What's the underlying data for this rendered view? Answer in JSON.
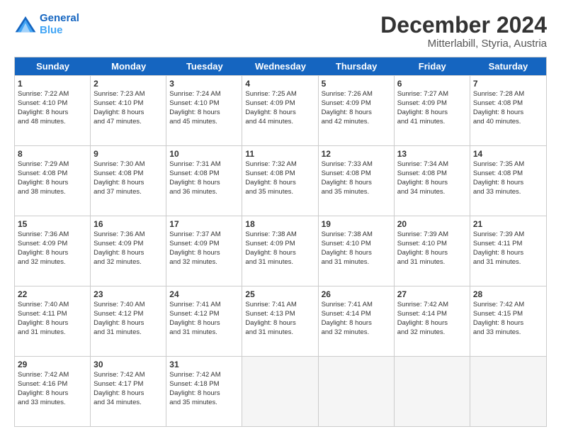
{
  "header": {
    "logo_line1": "General",
    "logo_line2": "Blue",
    "month": "December 2024",
    "location": "Mitterlabill, Styria, Austria"
  },
  "weekdays": [
    "Sunday",
    "Monday",
    "Tuesday",
    "Wednesday",
    "Thursday",
    "Friday",
    "Saturday"
  ],
  "weeks": [
    [
      {
        "day": "1",
        "lines": [
          "Sunrise: 7:22 AM",
          "Sunset: 4:10 PM",
          "Daylight: 8 hours",
          "and 48 minutes."
        ]
      },
      {
        "day": "2",
        "lines": [
          "Sunrise: 7:23 AM",
          "Sunset: 4:10 PM",
          "Daylight: 8 hours",
          "and 47 minutes."
        ]
      },
      {
        "day": "3",
        "lines": [
          "Sunrise: 7:24 AM",
          "Sunset: 4:10 PM",
          "Daylight: 8 hours",
          "and 45 minutes."
        ]
      },
      {
        "day": "4",
        "lines": [
          "Sunrise: 7:25 AM",
          "Sunset: 4:09 PM",
          "Daylight: 8 hours",
          "and 44 minutes."
        ]
      },
      {
        "day": "5",
        "lines": [
          "Sunrise: 7:26 AM",
          "Sunset: 4:09 PM",
          "Daylight: 8 hours",
          "and 42 minutes."
        ]
      },
      {
        "day": "6",
        "lines": [
          "Sunrise: 7:27 AM",
          "Sunset: 4:09 PM",
          "Daylight: 8 hours",
          "and 41 minutes."
        ]
      },
      {
        "day": "7",
        "lines": [
          "Sunrise: 7:28 AM",
          "Sunset: 4:08 PM",
          "Daylight: 8 hours",
          "and 40 minutes."
        ]
      }
    ],
    [
      {
        "day": "8",
        "lines": [
          "Sunrise: 7:29 AM",
          "Sunset: 4:08 PM",
          "Daylight: 8 hours",
          "and 38 minutes."
        ]
      },
      {
        "day": "9",
        "lines": [
          "Sunrise: 7:30 AM",
          "Sunset: 4:08 PM",
          "Daylight: 8 hours",
          "and 37 minutes."
        ]
      },
      {
        "day": "10",
        "lines": [
          "Sunrise: 7:31 AM",
          "Sunset: 4:08 PM",
          "Daylight: 8 hours",
          "and 36 minutes."
        ]
      },
      {
        "day": "11",
        "lines": [
          "Sunrise: 7:32 AM",
          "Sunset: 4:08 PM",
          "Daylight: 8 hours",
          "and 35 minutes."
        ]
      },
      {
        "day": "12",
        "lines": [
          "Sunrise: 7:33 AM",
          "Sunset: 4:08 PM",
          "Daylight: 8 hours",
          "and 35 minutes."
        ]
      },
      {
        "day": "13",
        "lines": [
          "Sunrise: 7:34 AM",
          "Sunset: 4:08 PM",
          "Daylight: 8 hours",
          "and 34 minutes."
        ]
      },
      {
        "day": "14",
        "lines": [
          "Sunrise: 7:35 AM",
          "Sunset: 4:08 PM",
          "Daylight: 8 hours",
          "and 33 minutes."
        ]
      }
    ],
    [
      {
        "day": "15",
        "lines": [
          "Sunrise: 7:36 AM",
          "Sunset: 4:09 PM",
          "Daylight: 8 hours",
          "and 32 minutes."
        ]
      },
      {
        "day": "16",
        "lines": [
          "Sunrise: 7:36 AM",
          "Sunset: 4:09 PM",
          "Daylight: 8 hours",
          "and 32 minutes."
        ]
      },
      {
        "day": "17",
        "lines": [
          "Sunrise: 7:37 AM",
          "Sunset: 4:09 PM",
          "Daylight: 8 hours",
          "and 32 minutes."
        ]
      },
      {
        "day": "18",
        "lines": [
          "Sunrise: 7:38 AM",
          "Sunset: 4:09 PM",
          "Daylight: 8 hours",
          "and 31 minutes."
        ]
      },
      {
        "day": "19",
        "lines": [
          "Sunrise: 7:38 AM",
          "Sunset: 4:10 PM",
          "Daylight: 8 hours",
          "and 31 minutes."
        ]
      },
      {
        "day": "20",
        "lines": [
          "Sunrise: 7:39 AM",
          "Sunset: 4:10 PM",
          "Daylight: 8 hours",
          "and 31 minutes."
        ]
      },
      {
        "day": "21",
        "lines": [
          "Sunrise: 7:39 AM",
          "Sunset: 4:11 PM",
          "Daylight: 8 hours",
          "and 31 minutes."
        ]
      }
    ],
    [
      {
        "day": "22",
        "lines": [
          "Sunrise: 7:40 AM",
          "Sunset: 4:11 PM",
          "Daylight: 8 hours",
          "and 31 minutes."
        ]
      },
      {
        "day": "23",
        "lines": [
          "Sunrise: 7:40 AM",
          "Sunset: 4:12 PM",
          "Daylight: 8 hours",
          "and 31 minutes."
        ]
      },
      {
        "day": "24",
        "lines": [
          "Sunrise: 7:41 AM",
          "Sunset: 4:12 PM",
          "Daylight: 8 hours",
          "and 31 minutes."
        ]
      },
      {
        "day": "25",
        "lines": [
          "Sunrise: 7:41 AM",
          "Sunset: 4:13 PM",
          "Daylight: 8 hours",
          "and 31 minutes."
        ]
      },
      {
        "day": "26",
        "lines": [
          "Sunrise: 7:41 AM",
          "Sunset: 4:14 PM",
          "Daylight: 8 hours",
          "and 32 minutes."
        ]
      },
      {
        "day": "27",
        "lines": [
          "Sunrise: 7:42 AM",
          "Sunset: 4:14 PM",
          "Daylight: 8 hours",
          "and 32 minutes."
        ]
      },
      {
        "day": "28",
        "lines": [
          "Sunrise: 7:42 AM",
          "Sunset: 4:15 PM",
          "Daylight: 8 hours",
          "and 33 minutes."
        ]
      }
    ],
    [
      {
        "day": "29",
        "lines": [
          "Sunrise: 7:42 AM",
          "Sunset: 4:16 PM",
          "Daylight: 8 hours",
          "and 33 minutes."
        ]
      },
      {
        "day": "30",
        "lines": [
          "Sunrise: 7:42 AM",
          "Sunset: 4:17 PM",
          "Daylight: 8 hours",
          "and 34 minutes."
        ]
      },
      {
        "day": "31",
        "lines": [
          "Sunrise: 7:42 AM",
          "Sunset: 4:18 PM",
          "Daylight: 8 hours",
          "and 35 minutes."
        ]
      },
      {
        "day": "",
        "lines": []
      },
      {
        "day": "",
        "lines": []
      },
      {
        "day": "",
        "lines": []
      },
      {
        "day": "",
        "lines": []
      }
    ]
  ]
}
